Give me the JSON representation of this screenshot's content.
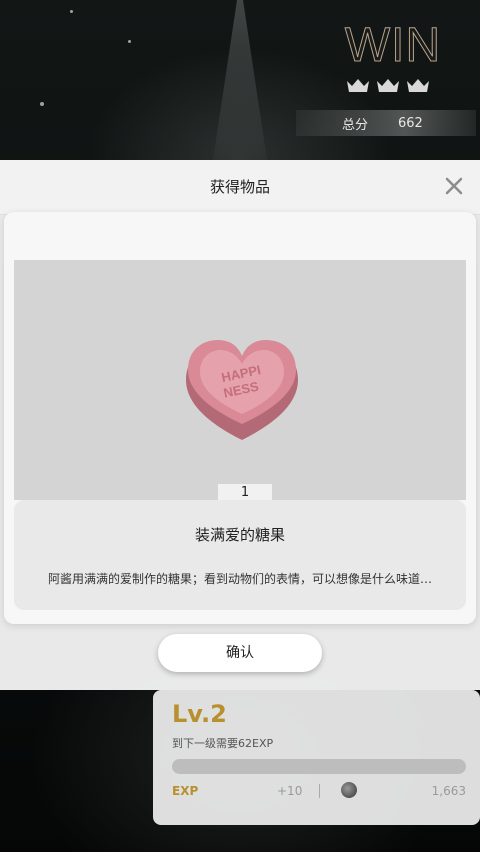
{
  "result": {
    "title": "WIN",
    "score_label": "总分",
    "score_value": "662",
    "level": "Lv.2",
    "next_level_text": "到下一级需要62EXP",
    "exp_label": "EXP",
    "exp_gain": "+10",
    "coin_total": "1,663"
  },
  "modal": {
    "title": "获得物品",
    "item_quantity": "1",
    "item_name": "装满爱的糖果",
    "item_description": "阿酱用满满的爱制作的糖果；看到动物们的表情，可以想像是什么味道…",
    "candy_text_line1": "HAPPI",
    "candy_text_line2": "NESS",
    "confirm_label": "确认"
  },
  "icons": [
    "close-icon",
    "crown-icon",
    "coin-icon"
  ],
  "colors": {
    "gold": "#b8902e",
    "candy": "#d98a96"
  }
}
